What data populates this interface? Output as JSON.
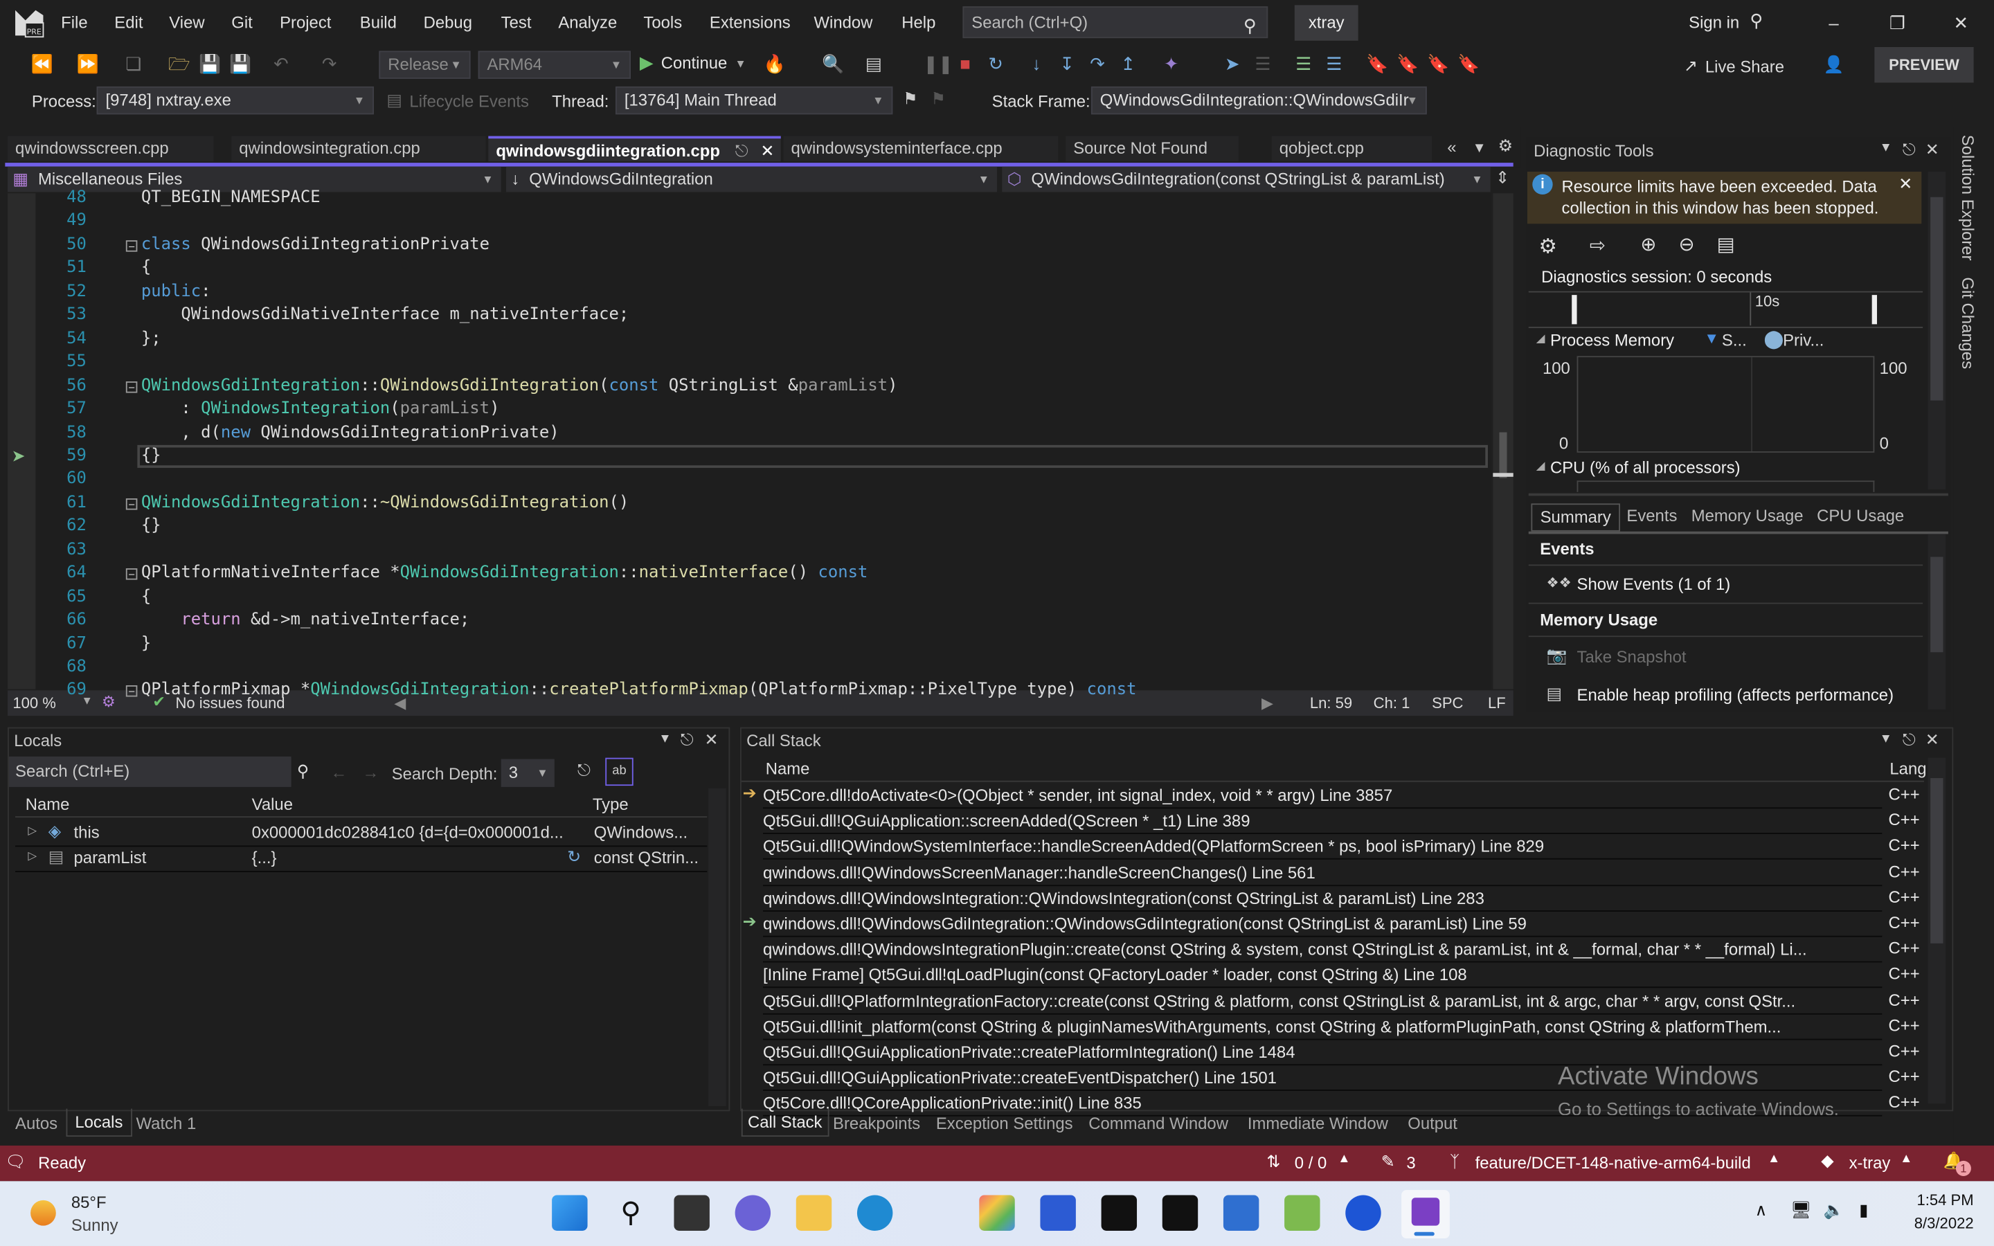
{
  "menubar": {
    "items": [
      "File",
      "Edit",
      "View",
      "Git",
      "Project",
      "Build",
      "Debug",
      "Test",
      "Analyze",
      "Tools",
      "Extensions",
      "Window",
      "Help"
    ],
    "search_placeholder": "Search (Ctrl+Q)",
    "solution_name": "xtray",
    "sign_in": "Sign in"
  },
  "toolbar": {
    "configuration": "Release",
    "platform": "ARM64",
    "continue_label": "Continue",
    "live_share": "Live Share",
    "preview_label": "PREVIEW"
  },
  "debug_location": {
    "process_label": "Process:",
    "process_value": "[9748] nxtray.exe",
    "lifecycle_label": "Lifecycle Events",
    "thread_label": "Thread:",
    "thread_value": "[13764] Main Thread",
    "stack_frame_label": "Stack Frame:",
    "stack_frame_value": "QWindowsGdiIntegration::QWindowsGdiIr"
  },
  "tabs": [
    {
      "label": "qwindowsscreen.cpp",
      "active": false
    },
    {
      "label": "qwindowsintegration.cpp",
      "active": false
    },
    {
      "label": "qwindowsgdiintegration.cpp",
      "active": true
    },
    {
      "label": "qwindowsysteminterface.cpp",
      "active": false
    },
    {
      "label": "Source Not Found",
      "active": false
    },
    {
      "label": "qobject.cpp",
      "active": false
    }
  ],
  "navbar": {
    "project": "Miscellaneous Files",
    "scope": "QWindowsGdiIntegration",
    "member": "QWindowsGdiIntegration(const QStringList & paramList)"
  },
  "editor": {
    "lines": [
      {
        "n": "48",
        "text": "QT_BEGIN_NAMESPACE"
      },
      {
        "n": "49",
        "text": ""
      },
      {
        "n": "50",
        "text": "class QWindowsGdiIntegrationPrivate"
      },
      {
        "n": "51",
        "text": "{"
      },
      {
        "n": "52",
        "text": "public:"
      },
      {
        "n": "53",
        "text": "    QWindowsGdiNativeInterface m_nativeInterface;"
      },
      {
        "n": "54",
        "text": "};"
      },
      {
        "n": "55",
        "text": ""
      },
      {
        "n": "56",
        "text": "QWindowsGdiIntegration::QWindowsGdiIntegration(const QStringList &paramList)"
      },
      {
        "n": "57",
        "text": "    : QWindowsIntegration(paramList)"
      },
      {
        "n": "58",
        "text": "    , d(new QWindowsGdiIntegrationPrivate)"
      },
      {
        "n": "59",
        "text": "{}"
      },
      {
        "n": "60",
        "text": ""
      },
      {
        "n": "61",
        "text": "QWindowsGdiIntegration::~QWindowsGdiIntegration()"
      },
      {
        "n": "62",
        "text": "{}"
      },
      {
        "n": "63",
        "text": ""
      },
      {
        "n": "64",
        "text": "QPlatformNativeInterface *QWindowsGdiIntegration::nativeInterface() const"
      },
      {
        "n": "65",
        "text": "{"
      },
      {
        "n": "66",
        "text": "    return &d->m_nativeInterface;"
      },
      {
        "n": "67",
        "text": "}"
      },
      {
        "n": "68",
        "text": ""
      },
      {
        "n": "69",
        "text": "QPlatformPixmap *QWindowsGdiIntegration::createPlatformPixmap(QPlatformPixmap::PixelType type) const"
      }
    ],
    "current_line": "59"
  },
  "editor_status": {
    "zoom": "100 %",
    "issues": "No issues found",
    "line": "Ln: 59",
    "col": "Ch: 1",
    "whitespace": "SPC",
    "line_ending": "LF"
  },
  "diagnostics": {
    "title": "Diagnostic Tools",
    "banner": "Resource limits have been exceeded. Data collection in this window has been stopped.",
    "session": "Diagnostics session: 0 seconds",
    "timeline_label": "10s",
    "process_memory": "Process Memory",
    "legend_snapshot": "S...",
    "legend_private": "Priv...",
    "axis_max": "100",
    "axis_min": "0",
    "cpu": "CPU (% of all processors)",
    "tabs": [
      "Summary",
      "Events",
      "Memory Usage",
      "CPU Usage"
    ],
    "events_header": "Events",
    "show_events": "Show Events (1 of 1)",
    "memory_header": "Memory Usage",
    "take_snapshot": "Take Snapshot",
    "heap_profiling": "Enable heap profiling (affects performance)"
  },
  "side_tabs": [
    "Solution Explorer",
    "Git Changes"
  ],
  "locals": {
    "title": "Locals",
    "search_placeholder": "Search (Ctrl+E)",
    "depth_label": "Search Depth:",
    "depth_value": "3",
    "columns": [
      "Name",
      "Value",
      "Type"
    ],
    "rows": [
      {
        "name": "this",
        "value": "0x000001dc028841c0 {d={d=0x000001d...",
        "type": "QWindows..."
      },
      {
        "name": "paramList",
        "value": "{...}",
        "type": "const QStrin..."
      }
    ],
    "bottom_tabs": [
      "Autos",
      "Locals",
      "Watch 1"
    ]
  },
  "callstack": {
    "title": "Call Stack",
    "columns": [
      "Name",
      "Lang"
    ],
    "rows": [
      {
        "name": "Qt5Core.dll!doActivate<0>(QObject * sender, int signal_index, void * * argv) Line 3857",
        "lang": "C++",
        "marker": "current"
      },
      {
        "name": "Qt5Gui.dll!QGuiApplication::screenAdded(QScreen * _t1) Line 389",
        "lang": "C++",
        "marker": ""
      },
      {
        "name": "Qt5Gui.dll!QWindowSystemInterface::handleScreenAdded(QPlatformScreen * ps, bool isPrimary) Line 829",
        "lang": "C++",
        "marker": ""
      },
      {
        "name": "qwindows.dll!QWindowsScreenManager::handleScreenChanges() Line 561",
        "lang": "C++",
        "marker": ""
      },
      {
        "name": "qwindows.dll!QWindowsIntegration::QWindowsIntegration(const QStringList & paramList) Line 283",
        "lang": "C++",
        "marker": ""
      },
      {
        "name": "qwindows.dll!QWindowsGdiIntegration::QWindowsGdiIntegration(const QStringList & paramList) Line 59",
        "lang": "C++",
        "marker": "frame"
      },
      {
        "name": "qwindows.dll!QWindowsIntegrationPlugin::create(const QString & system, const QStringList & paramList, int & __formal, char * * __formal) Li...",
        "lang": "C++",
        "marker": ""
      },
      {
        "name": "[Inline Frame] Qt5Gui.dll!qLoadPlugin(const QFactoryLoader * loader, const QString &) Line 108",
        "lang": "C++",
        "marker": ""
      },
      {
        "name": "Qt5Gui.dll!QPlatformIntegrationFactory::create(const QString & platform, const QStringList & paramList, int & argc, char * * argv, const QStr...",
        "lang": "C++",
        "marker": ""
      },
      {
        "name": "Qt5Gui.dll!init_platform(const QString & pluginNamesWithArguments, const QString & platformPluginPath, const QString & platformThem...",
        "lang": "C++",
        "marker": ""
      },
      {
        "name": "Qt5Gui.dll!QGuiApplicationPrivate::createPlatformIntegration() Line 1484",
        "lang": "C++",
        "marker": ""
      },
      {
        "name": "Qt5Gui.dll!QGuiApplicationPrivate::createEventDispatcher() Line 1501",
        "lang": "C++",
        "marker": ""
      },
      {
        "name": "Qt5Core.dll!QCoreApplicationPrivate::init() Line 835",
        "lang": "C++",
        "marker": ""
      }
    ],
    "bottom_tabs": [
      "Call Stack",
      "Breakpoints",
      "Exception Settings",
      "Command Window",
      "Immediate Window",
      "Output"
    ]
  },
  "watermark": {
    "title": "Activate Windows",
    "subtitle": "Go to Settings to activate Windows."
  },
  "statusbar": {
    "ready": "Ready",
    "sync": "0 / 0",
    "changes": "3",
    "branch": "feature/DCET-148-native-arm64-build",
    "repo": "x-tray",
    "notifications": "1"
  },
  "taskbar": {
    "temperature": "85°F",
    "weather": "Sunny",
    "time": "1:54 PM",
    "date": "8/3/2022"
  },
  "colors": {
    "accent": "#7160e8",
    "statusbar": "#7a2330",
    "banner": "#3f3523"
  }
}
